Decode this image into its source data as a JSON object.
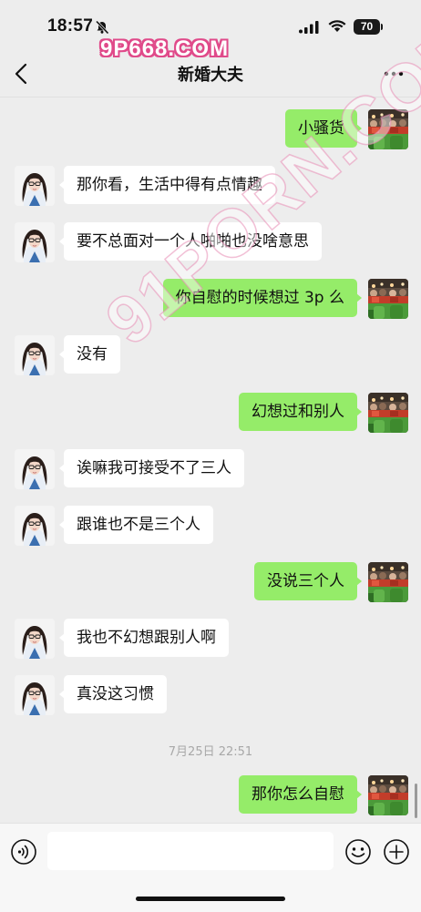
{
  "status_bar": {
    "time": "18:57",
    "battery": "70"
  },
  "watermark": {
    "top": "9P668.COM",
    "diagonal": "91PORN.COM"
  },
  "header": {
    "title": "新婚大夫"
  },
  "messages": [
    {
      "side": "right",
      "text": "小骚货"
    },
    {
      "side": "left",
      "text": "那你看，生活中得有点情趣"
    },
    {
      "side": "left",
      "text": "要不总面对一个人啪啪也没啥意思"
    },
    {
      "side": "right",
      "text": "你自慰的时候想过 3p 么"
    },
    {
      "side": "left",
      "text": "没有"
    },
    {
      "side": "right",
      "text": "幻想过和别人"
    },
    {
      "side": "left",
      "text": "诶嘛我可接受不了三人"
    },
    {
      "side": "left",
      "text": "跟谁也不是三个人"
    },
    {
      "side": "right",
      "text": "没说三个人"
    },
    {
      "side": "left",
      "text": "我也不幻想跟别人啊"
    },
    {
      "side": "left",
      "text": "真没这习惯"
    },
    {
      "side": "right",
      "text": "那你怎么自慰"
    }
  ],
  "timestamp": "7月25日 22:51",
  "input": {
    "value": "",
    "placeholder": ""
  },
  "icons": {
    "back": "chevron-left-icon",
    "more": "more-icon",
    "voice": "voice-icon",
    "emoji": "emoji-icon",
    "plus": "plus-icon"
  },
  "colors": {
    "background": "#ededed",
    "sent_bubble": "#95ec69",
    "received_bubble": "#ffffff",
    "timestamp_text": "#a8a8a8"
  }
}
